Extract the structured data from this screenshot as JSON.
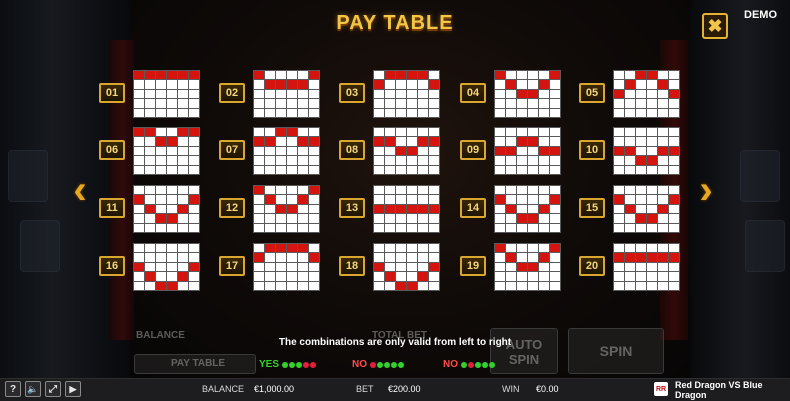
{
  "paytable": {
    "title": "PAY TABLE",
    "demo_label": "DEMO",
    "close_icon": "✖",
    "prev_icon": "‹",
    "next_icon": "›",
    "note": "The combinations are only valid from left to right",
    "legend": [
      {
        "label": "YES",
        "color": "#33d12b",
        "dots": [
          "#33d12b",
          "#33d12b",
          "#33d12b",
          "#e0203a",
          "#e0203a"
        ]
      },
      {
        "label": "NO",
        "color": "#ff4a4a",
        "dots": [
          "#e0203a",
          "#33d12b",
          "#33d12b",
          "#33d12b",
          "#33d12b"
        ]
      },
      {
        "label": "NO",
        "color": "#ff4a4a",
        "dots": [
          "#33d12b",
          "#e0203a",
          "#33d12b",
          "#33d12b",
          "#33d12b"
        ]
      }
    ],
    "lines": [
      {
        "num": "01",
        "rows": [
          0,
          0,
          0,
          0,
          0,
          0
        ]
      },
      {
        "num": "02",
        "rows": [
          0,
          1,
          1,
          1,
          1,
          0
        ]
      },
      {
        "num": "03",
        "rows": [
          1,
          0,
          0,
          0,
          0,
          1
        ]
      },
      {
        "num": "04",
        "rows": [
          0,
          1,
          2,
          2,
          1,
          0
        ]
      },
      {
        "num": "05",
        "rows": [
          2,
          1,
          0,
          0,
          1,
          2
        ]
      },
      {
        "num": "06",
        "rows": [
          0,
          0,
          1,
          1,
          0,
          0
        ]
      },
      {
        "num": "07",
        "rows": [
          1,
          1,
          0,
          0,
          1,
          1
        ]
      },
      {
        "num": "08",
        "rows": [
          1,
          1,
          2,
          2,
          1,
          1
        ]
      },
      {
        "num": "09",
        "rows": [
          2,
          2,
          1,
          1,
          2,
          2
        ]
      },
      {
        "num": "10",
        "rows": [
          2,
          2,
          3,
          3,
          2,
          2
        ]
      },
      {
        "num": "11",
        "rows": [
          1,
          2,
          3,
          3,
          2,
          1
        ]
      },
      {
        "num": "12",
        "rows": [
          0,
          1,
          2,
          2,
          1,
          0
        ]
      },
      {
        "num": "13",
        "rows": [
          2,
          2,
          2,
          2,
          2,
          2
        ]
      },
      {
        "num": "14",
        "rows": [
          1,
          2,
          3,
          3,
          2,
          1
        ]
      },
      {
        "num": "15",
        "rows": [
          1,
          2,
          3,
          3,
          2,
          1
        ]
      },
      {
        "num": "16",
        "rows": [
          2,
          3,
          4,
          4,
          3,
          2
        ]
      },
      {
        "num": "17",
        "rows": [
          1,
          0,
          0,
          0,
          0,
          1
        ]
      },
      {
        "num": "18",
        "rows": [
          2,
          3,
          4,
          4,
          3,
          2
        ]
      },
      {
        "num": "19",
        "rows": [
          0,
          1,
          2,
          2,
          1,
          0
        ]
      },
      {
        "num": "20",
        "rows": [
          1,
          1,
          1,
          1,
          1,
          1
        ]
      }
    ]
  },
  "underlay": {
    "balance_label": "BALANCE",
    "paytable_label": "PAY TABLE",
    "total_bet_label": "TOTAL BET",
    "auto_spin_label": "AUTO SPIN",
    "spin_label": "SPIN"
  },
  "bottom_bar": {
    "help_icon": "?",
    "sound_icon": "🔈",
    "fullscreen_icon": "⤢",
    "play_icon": "▶",
    "balance_label": "BALANCE",
    "balance_value": "€1,000.00",
    "bet_label": "BET",
    "bet_value": "€200.00",
    "win_label": "WIN",
    "win_value": "€0.00",
    "logo_text": "RR",
    "game_title": "Red Dragon VS Blue Dragon"
  }
}
